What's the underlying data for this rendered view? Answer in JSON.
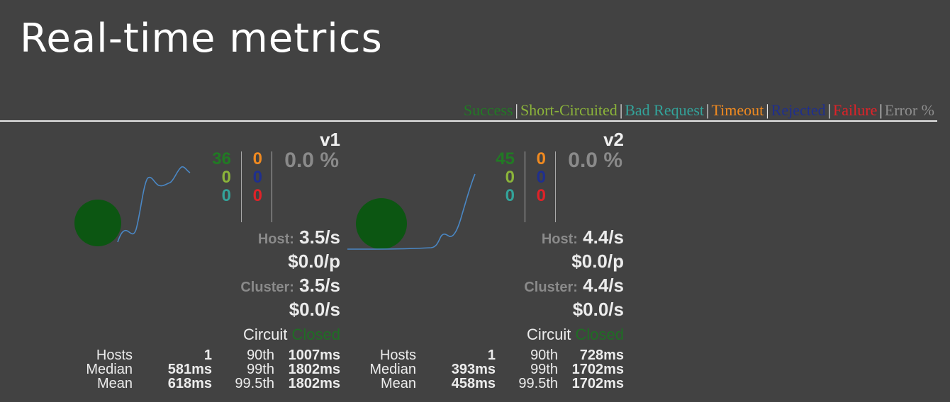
{
  "page_title": "Real-time metrics",
  "legend": [
    {
      "label": "Success",
      "color": "#217a24"
    },
    {
      "label": "Short-Circuited",
      "color": "#8bb43a"
    },
    {
      "label": "Bad Request",
      "color": "#33a39a"
    },
    {
      "label": "Timeout",
      "color": "#f08a20"
    },
    {
      "label": "Rejected",
      "color": "#1f2f8e"
    },
    {
      "label": "Failure",
      "color": "#e02228"
    },
    {
      "label": "Error %",
      "color": "#8e8e8e"
    }
  ],
  "circuits": [
    {
      "name": "v1",
      "success": "36",
      "short_circuited": "0",
      "bad_request": "0",
      "timeout": "0",
      "rejected": "0",
      "failure": "0",
      "error_pct": "0.0 %",
      "host_label": "Host:",
      "host_rate": "3.5/s",
      "host_cost": "$0.0/p",
      "cluster_label": "Cluster:",
      "cluster_rate": "3.5/s",
      "cluster_cost": "$0.0/s",
      "circuit_label": "Circuit",
      "circuit_status": "Closed",
      "stats": {
        "hosts_label": "Hosts",
        "hosts": "1",
        "median_label": "Median",
        "median": "581ms",
        "mean_label": "Mean",
        "mean": "618ms",
        "p90_label": "90th",
        "p90": "1007ms",
        "p99_label": "99th",
        "p99": "1802ms",
        "p995_label": "99.5th",
        "p995": "1802ms"
      }
    },
    {
      "name": "v2",
      "success": "45",
      "short_circuited": "0",
      "bad_request": "0",
      "timeout": "0",
      "rejected": "0",
      "failure": "0",
      "error_pct": "0.0 %",
      "host_label": "Host:",
      "host_rate": "4.4/s",
      "host_cost": "$0.0/p",
      "cluster_label": "Cluster:",
      "cluster_rate": "4.4/s",
      "cluster_cost": "$0.0/s",
      "circuit_label": "Circuit",
      "circuit_status": "Closed",
      "stats": {
        "hosts_label": "Hosts",
        "hosts": "1",
        "median_label": "Median",
        "median": "393ms",
        "mean_label": "Mean",
        "mean": "458ms",
        "p90_label": "90th",
        "p90": "728ms",
        "p99_label": "99th",
        "p99": "1702ms",
        "p995_label": "99.5th",
        "p995": "1702ms"
      }
    }
  ]
}
